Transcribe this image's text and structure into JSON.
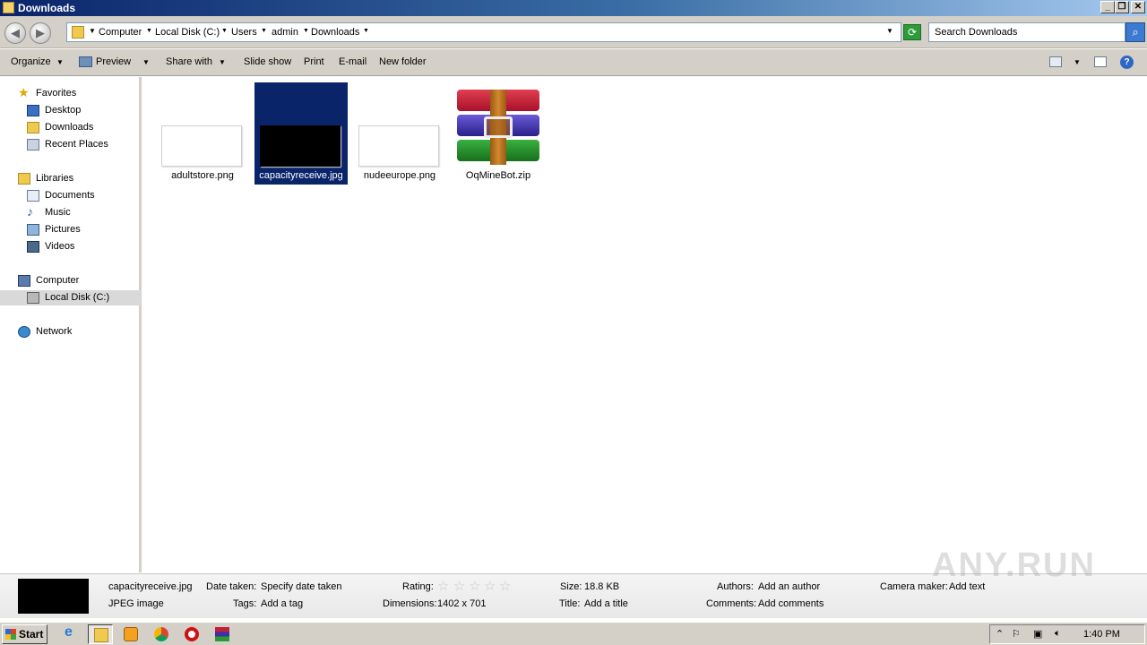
{
  "window": {
    "title": "Downloads"
  },
  "address": {
    "crumbs": [
      "Computer",
      "Local Disk (C:)",
      "Users",
      "admin",
      "Downloads"
    ]
  },
  "search": {
    "placeholder": "Search Downloads"
  },
  "commands": {
    "organize": "Organize",
    "preview": "Preview",
    "share_with": "Share with",
    "slide_show": "Slide show",
    "print": "Print",
    "email": "E-mail",
    "new_folder": "New folder"
  },
  "nav": {
    "favorites": "Favorites",
    "desktop": "Desktop",
    "downloads": "Downloads",
    "recent_places": "Recent Places",
    "libraries": "Libraries",
    "documents": "Documents",
    "music": "Music",
    "pictures": "Pictures",
    "videos": "Videos",
    "computer": "Computer",
    "local_disk": "Local Disk (C:)",
    "network": "Network"
  },
  "files": [
    {
      "name": "adultstore.png",
      "selected": false
    },
    {
      "name": "capacityreceive.jpg",
      "selected": true
    },
    {
      "name": "nudeeurope.png",
      "selected": false
    },
    {
      "name": "OqMineBot.zip",
      "selected": false
    }
  ],
  "details": {
    "filename": "capacityreceive.jpg",
    "filetype": "JPEG image",
    "date_taken_label": "Date taken:",
    "date_taken_value": "Specify date taken",
    "tags_label": "Tags:",
    "tags_value": "Add a tag",
    "rating_label": "Rating:",
    "rating_stars": 0,
    "rating_max": 5,
    "dimensions_label": "Dimensions:",
    "dimensions_value": "1402 x 701",
    "size_label": "Size:",
    "size_value": "18.8 KB",
    "title_label": "Title:",
    "title_value": "Add a title",
    "authors_label": "Authors:",
    "authors_value": "Add an author",
    "comments_label": "Comments:",
    "comments_value": "Add comments",
    "camera_label": "Camera maker:",
    "camera_value": "Add text"
  },
  "watermark": "ANY.RUN",
  "taskbar": {
    "start": "Start",
    "clock": "1:40 PM",
    "apps": [
      "internet-explorer",
      "windows-explorer",
      "media-player",
      "chrome",
      "opera",
      "winrar"
    ]
  }
}
